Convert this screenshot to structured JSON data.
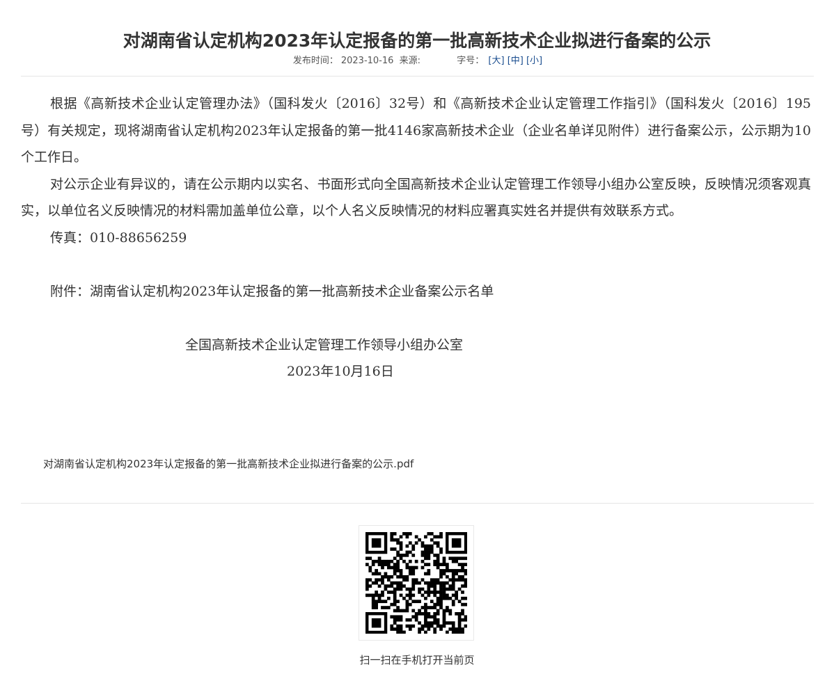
{
  "title": "对湖南省认定机构2023年认定报备的第一批高新技术企业拟进行备案的公示",
  "meta": {
    "publish_label": "发布时间：",
    "publish_date": "2023-10-16",
    "source_label": "来源:",
    "font_size_label": "字号：",
    "size_large": "[大]",
    "size_medium": "[中]",
    "size_small": "[小]"
  },
  "article": {
    "paragraph1": "根据《高新技术企业认定管理办法》（国科发火〔2016〕32号）和《高新技术企业认定管理工作指引》（国科发火〔2016〕195号）有关规定，现将湖南省认定机构2023年认定报备的第一批4146家高新技术企业（企业名单详见附件）进行备案公示，公示期为10个工作日。",
    "paragraph2": "对公示企业有异议的，请在公示期内以实名、书面形式向全国高新技术企业认定管理工作领导小组办公室反映，反映情况须客观真实，以单位名义反映情况的材料需加盖单位公章，以个人名义反映情况的材料应署真实姓名并提供有效联系方式。",
    "fax": "传真：010-88656259",
    "attachment_note": "附件：湖南省认定机构2023年认定报备的第一批高新技术企业备案公示名单",
    "signature": "全国高新技术企业认定管理工作领导小组办公室",
    "date": "2023年10月16日"
  },
  "attachment_file": "对湖南省认定机构2023年认定报备的第一批高新技术企业拟进行备案的公示.pdf",
  "qr_caption": "扫一扫在手机打开当前页",
  "colors": {
    "link": "#1a4d8f",
    "text": "#333333",
    "divider": "#e5e5e5"
  },
  "icons": [
    "qr-code-icon"
  ]
}
